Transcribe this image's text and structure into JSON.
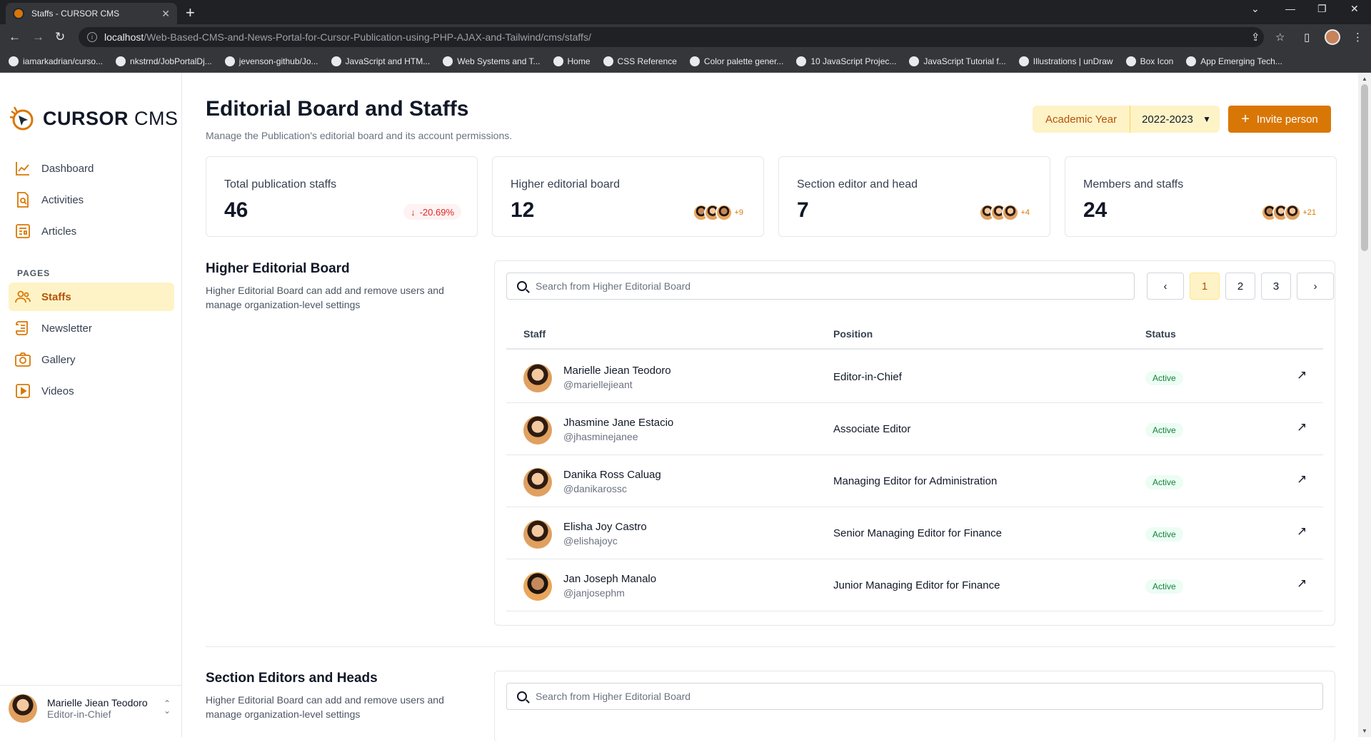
{
  "browser": {
    "tab_title": "Staffs - CURSOR CMS",
    "url_host": "localhost",
    "url_path": "/Web-Based-CMS-and-News-Portal-for-Cursor-Publication-using-PHP-AJAX-and-Tailwind/cms/staffs/",
    "bookmarks": [
      "iamarkadrian/curso...",
      "nkstrnd/JobPortalDj...",
      "jevenson-github/Jo...",
      "JavaScript and HTM...",
      "Web Systems and T...",
      "Home",
      "CSS Reference",
      "Color palette gener...",
      "10 JavaScript Projec...",
      "JavaScript Tutorial f...",
      "Illustrations | unDraw",
      "Box Icon",
      "App Emerging Tech..."
    ]
  },
  "brand": {
    "name_bold": "CURSOR",
    "name_light": "CMS",
    "accent": "#d97706",
    "accent_light": "#fef3c7"
  },
  "sidebar": {
    "items": [
      {
        "label": "Dashboard",
        "icon": "chart-line-icon"
      },
      {
        "label": "Activities",
        "icon": "document-search-icon"
      },
      {
        "label": "Articles",
        "icon": "newspaper-icon"
      }
    ],
    "pages_label": "PAGES",
    "pages": [
      {
        "label": "Staffs",
        "icon": "users-icon",
        "active": true
      },
      {
        "label": "Newsletter",
        "icon": "scroll-icon"
      },
      {
        "label": "Gallery",
        "icon": "camera-icon"
      },
      {
        "label": "Videos",
        "icon": "play-icon"
      }
    ],
    "user": {
      "name": "Marielle Jiean Teodoro",
      "role": "Editor-in-Chief"
    }
  },
  "header": {
    "title": "Editorial Board and Staffs",
    "subtitle": "Manage the Publication's editorial board and its account permissions.",
    "academic_year_label": "Academic Year",
    "academic_year_value": "2022-2023",
    "invite_label": "Invite person"
  },
  "stats": [
    {
      "label": "Total publication staffs",
      "value": "46",
      "change": "-20.69%"
    },
    {
      "label": "Higher editorial board",
      "value": "12",
      "more": "+9"
    },
    {
      "label": "Section editor and head",
      "value": "7",
      "more": "+4"
    },
    {
      "label": "Members and staffs",
      "value": "24",
      "more": "+21"
    }
  ],
  "higher_board": {
    "title": "Higher Editorial Board",
    "description": "Higher Editorial Board can add and remove users and manage organization-level settings",
    "search_placeholder": "Search from Higher Editorial Board",
    "pages": [
      "1",
      "2",
      "3"
    ],
    "columns": [
      "Staff",
      "Position",
      "Status"
    ],
    "rows": [
      {
        "name": "Marielle Jiean Teodoro",
        "handle": "@mariellejieant",
        "position": "Editor-in-Chief",
        "status": "Active"
      },
      {
        "name": "Jhasmine Jane Estacio",
        "handle": "@jhasminejanee",
        "position": "Associate Editor",
        "status": "Active"
      },
      {
        "name": "Danika Ross Caluag",
        "handle": "@danikarossc",
        "position": "Managing Editor for Administration",
        "status": "Active"
      },
      {
        "name": "Elisha Joy Castro",
        "handle": "@elishajoyc",
        "position": "Senior Managing Editor for Finance",
        "status": "Active"
      },
      {
        "name": "Jan Joseph Manalo",
        "handle": "@janjosephm",
        "position": "Junior Managing Editor for Finance",
        "status": "Active"
      }
    ]
  },
  "section_editors": {
    "title": "Section Editors and Heads",
    "description": "Higher Editorial Board can add and remove users and manage organization-level settings",
    "search_placeholder": "Search from Higher Editorial Board"
  }
}
